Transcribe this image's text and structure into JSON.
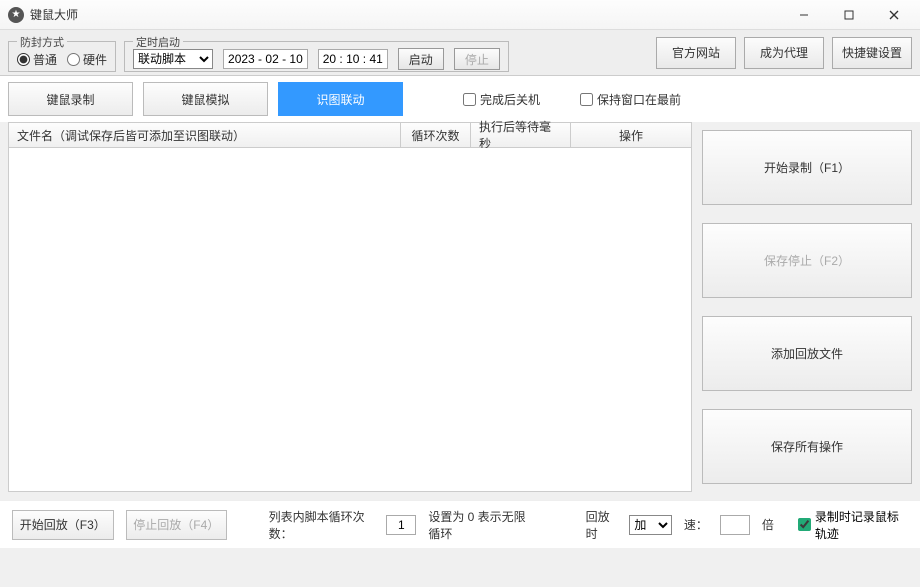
{
  "window": {
    "title": "键鼠大师"
  },
  "topButtons": {
    "official": "官方网站",
    "agent": "成为代理",
    "hotkey": "快捷键设置"
  },
  "antiban": {
    "legend": "防封方式",
    "opt1": "普通",
    "opt2": "硬件"
  },
  "timer": {
    "legend": "定时启动",
    "scriptOption": "联动脚本",
    "date": "2023 - 02 - 10",
    "time": "20 : 10 : 41",
    "start": "启动",
    "stop": "停止"
  },
  "tabs": {
    "record": "键鼠录制",
    "simulate": "键鼠模拟",
    "vision": "识图联动"
  },
  "checks": {
    "shutdown": "完成后关机",
    "topmost": "保持窗口在最前"
  },
  "table": {
    "col1": "文件名（调试保存后皆可添加至识图联动）",
    "col2": "循环次数",
    "col3": "执行后等待毫秒",
    "col4": "操作"
  },
  "side": {
    "startRec": "开始录制（F1）",
    "saveStop": "保存停止（F2）",
    "addPlay": "添加回放文件",
    "saveAll": "保存所有操作"
  },
  "footer": {
    "startPlay": "开始回放（F3）",
    "stopPlay": "停止回放（F4）",
    "loopLabel": "列表内脚本循环次数：",
    "loopVal": "1",
    "loopHint": "设置为 0 表示无限循环",
    "speedLabel": "回放时",
    "speedMode": "加",
    "speedLabel2": "速：",
    "speedVal": "",
    "speedUnit": "倍",
    "trackMouse": "录制时记录鼠标轨迹"
  }
}
